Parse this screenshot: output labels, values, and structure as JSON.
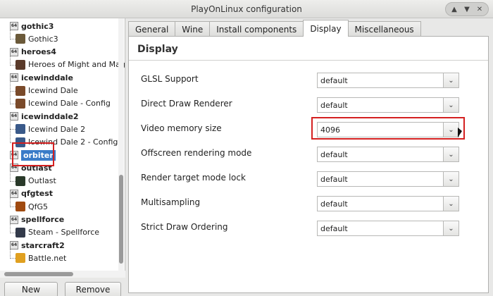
{
  "window": {
    "title": "PlayOnLinux configuration"
  },
  "sidebar": {
    "items": [
      {
        "label": "gothic3",
        "type": "parent"
      },
      {
        "label": "Gothic3",
        "type": "child",
        "icon": "#6b5a3a"
      },
      {
        "label": "heroes4",
        "type": "parent"
      },
      {
        "label": "Heroes of Might and Magic",
        "type": "child",
        "icon": "#5a3a2a"
      },
      {
        "label": "icewinddale",
        "type": "parent"
      },
      {
        "label": "Icewind Dale",
        "type": "child",
        "icon": "#7a4a2a"
      },
      {
        "label": "Icewind Dale - Config",
        "type": "child",
        "icon": "#7a4a2a"
      },
      {
        "label": "icewinddale2",
        "type": "parent"
      },
      {
        "label": "Icewind Dale 2",
        "type": "child",
        "icon": "#3a5a8a"
      },
      {
        "label": "Icewind Dale 2 - Config",
        "type": "child",
        "icon": "#3a5a8a"
      },
      {
        "label": "orbiter",
        "type": "parent",
        "selected": true
      },
      {
        "label": "outlast",
        "type": "parent"
      },
      {
        "label": "Outlast",
        "type": "child",
        "icon": "#2a3a2a"
      },
      {
        "label": "qfgtest",
        "type": "parent"
      },
      {
        "label": "QfG5",
        "type": "child",
        "icon": "#a04a10"
      },
      {
        "label": "spellforce",
        "type": "parent"
      },
      {
        "label": "Steam - Spellforce",
        "type": "child",
        "icon": "#333a4a"
      },
      {
        "label": "starcraft2",
        "type": "parent"
      },
      {
        "label": "Battle.net",
        "type": "child",
        "icon": "#e0a020"
      }
    ],
    "badge": "64"
  },
  "buttons": {
    "new": "New",
    "remove": "Remove"
  },
  "tabs": [
    {
      "label": "General"
    },
    {
      "label": "Wine"
    },
    {
      "label": "Install components"
    },
    {
      "label": "Display",
      "active": true
    },
    {
      "label": "Miscellaneous"
    }
  ],
  "panel": {
    "title": "Display",
    "settings": [
      {
        "label": "GLSL Support",
        "value": "default"
      },
      {
        "label": "Direct Draw Renderer",
        "value": "default"
      },
      {
        "label": "Video memory size",
        "value": "4096"
      },
      {
        "label": "Offscreen rendering mode",
        "value": "default"
      },
      {
        "label": "Render target mode lock",
        "value": "default"
      },
      {
        "label": "Multisampling",
        "value": "default"
      },
      {
        "label": "Strict Draw Ordering",
        "value": "default"
      }
    ]
  },
  "colors": {
    "selection": "#3a7bc8",
    "highlight": "#d42020"
  }
}
